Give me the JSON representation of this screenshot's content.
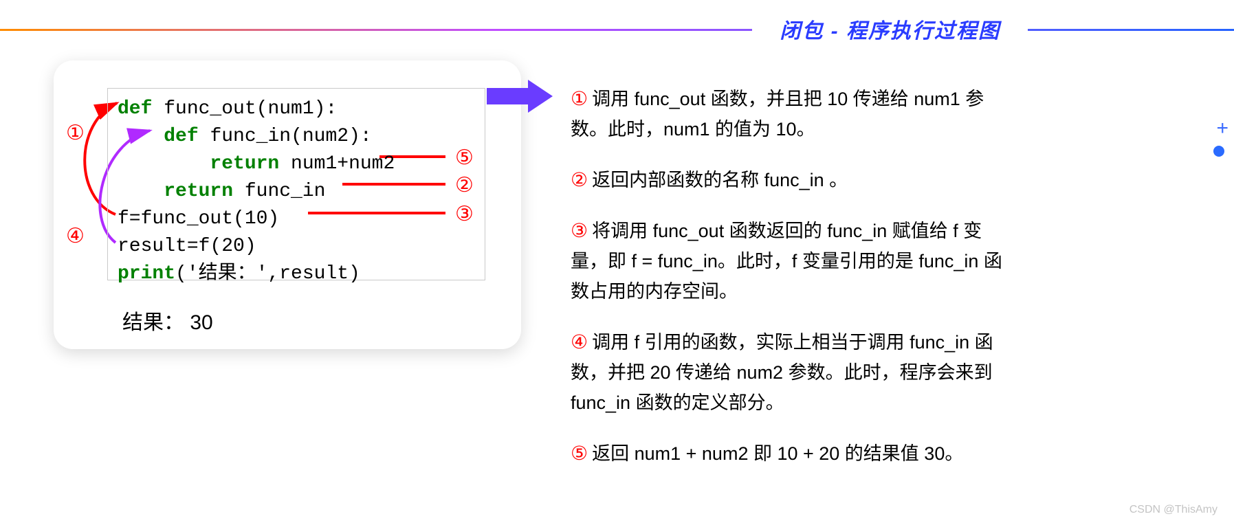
{
  "title": "闭包 - 程序执行过程图",
  "code": {
    "l1_def": "def",
    "l1_rest": " func_out(num1):",
    "l2_def": "def",
    "l2_rest": " func_in(num2):",
    "l3_ret": "return",
    "l3_rest": " num1+num2",
    "l4_ret": "return",
    "l4_rest": " func_in",
    "l5": "f=func_out(10)",
    "l6": "result=f(20)",
    "l7a": "print",
    "l7b": "('结果：',result)"
  },
  "output_label": "结果： 30",
  "ann": {
    "n1": "①",
    "n2": "②",
    "n3": "③",
    "n4": "④",
    "n5": "⑤"
  },
  "steps": {
    "s1": "调用 func_out 函数，并且把 10 传递给 num1 参数。此时，num1 的值为 10。",
    "s2": "返回内部函数的名称 func_in 。",
    "s3": "将调用 func_out 函数返回的 func_in 赋值给 f 变量，即 f = func_in。此时，f 变量引用的是 func_in 函数占用的内存空间。",
    "s4": "调用 f 引用的函数，实际上相当于调用 func_in 函数，并把 20 传递给 num2 参数。此时，程序会来到 func_in 函数的定义部分。",
    "s5": "返回 num1 + num2 即 10 + 20 的结果值 30。"
  },
  "watermark": "CSDN @ThisAmy",
  "side_plus": "+"
}
